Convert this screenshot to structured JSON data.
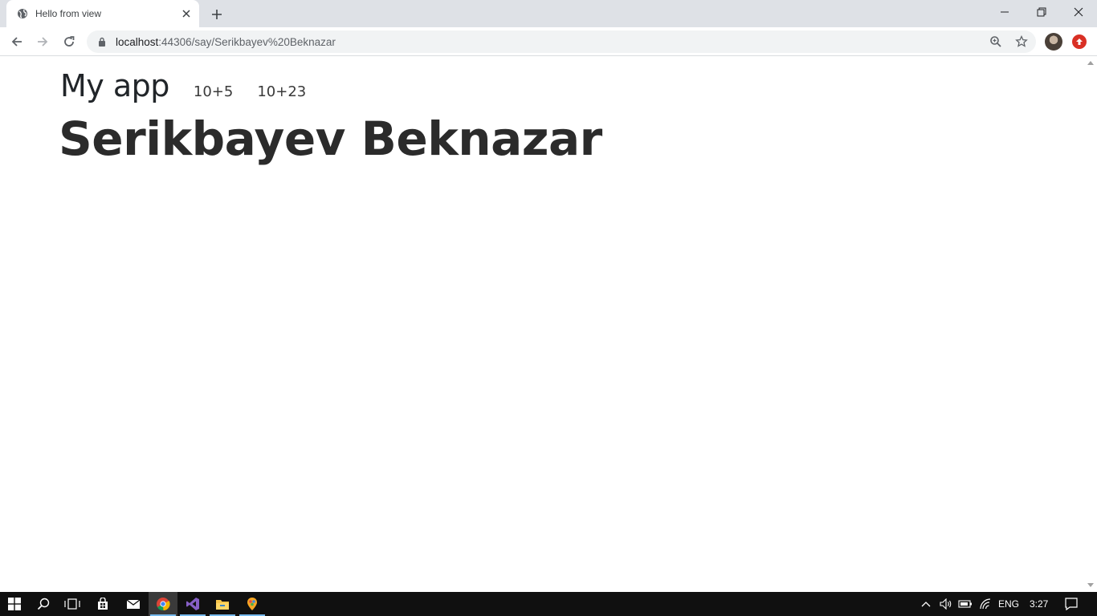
{
  "browser": {
    "tab_title": "Hello from view",
    "url_host": "localhost",
    "url_rest": ":44306/say/Serikbayev%20Beknazar"
  },
  "page": {
    "brand": "My app",
    "nav_links": [
      "10+5",
      "10+23"
    ],
    "heading": "Serikbayev Beknazar"
  },
  "taskbar": {
    "language": "ENG",
    "time": "3:27"
  }
}
